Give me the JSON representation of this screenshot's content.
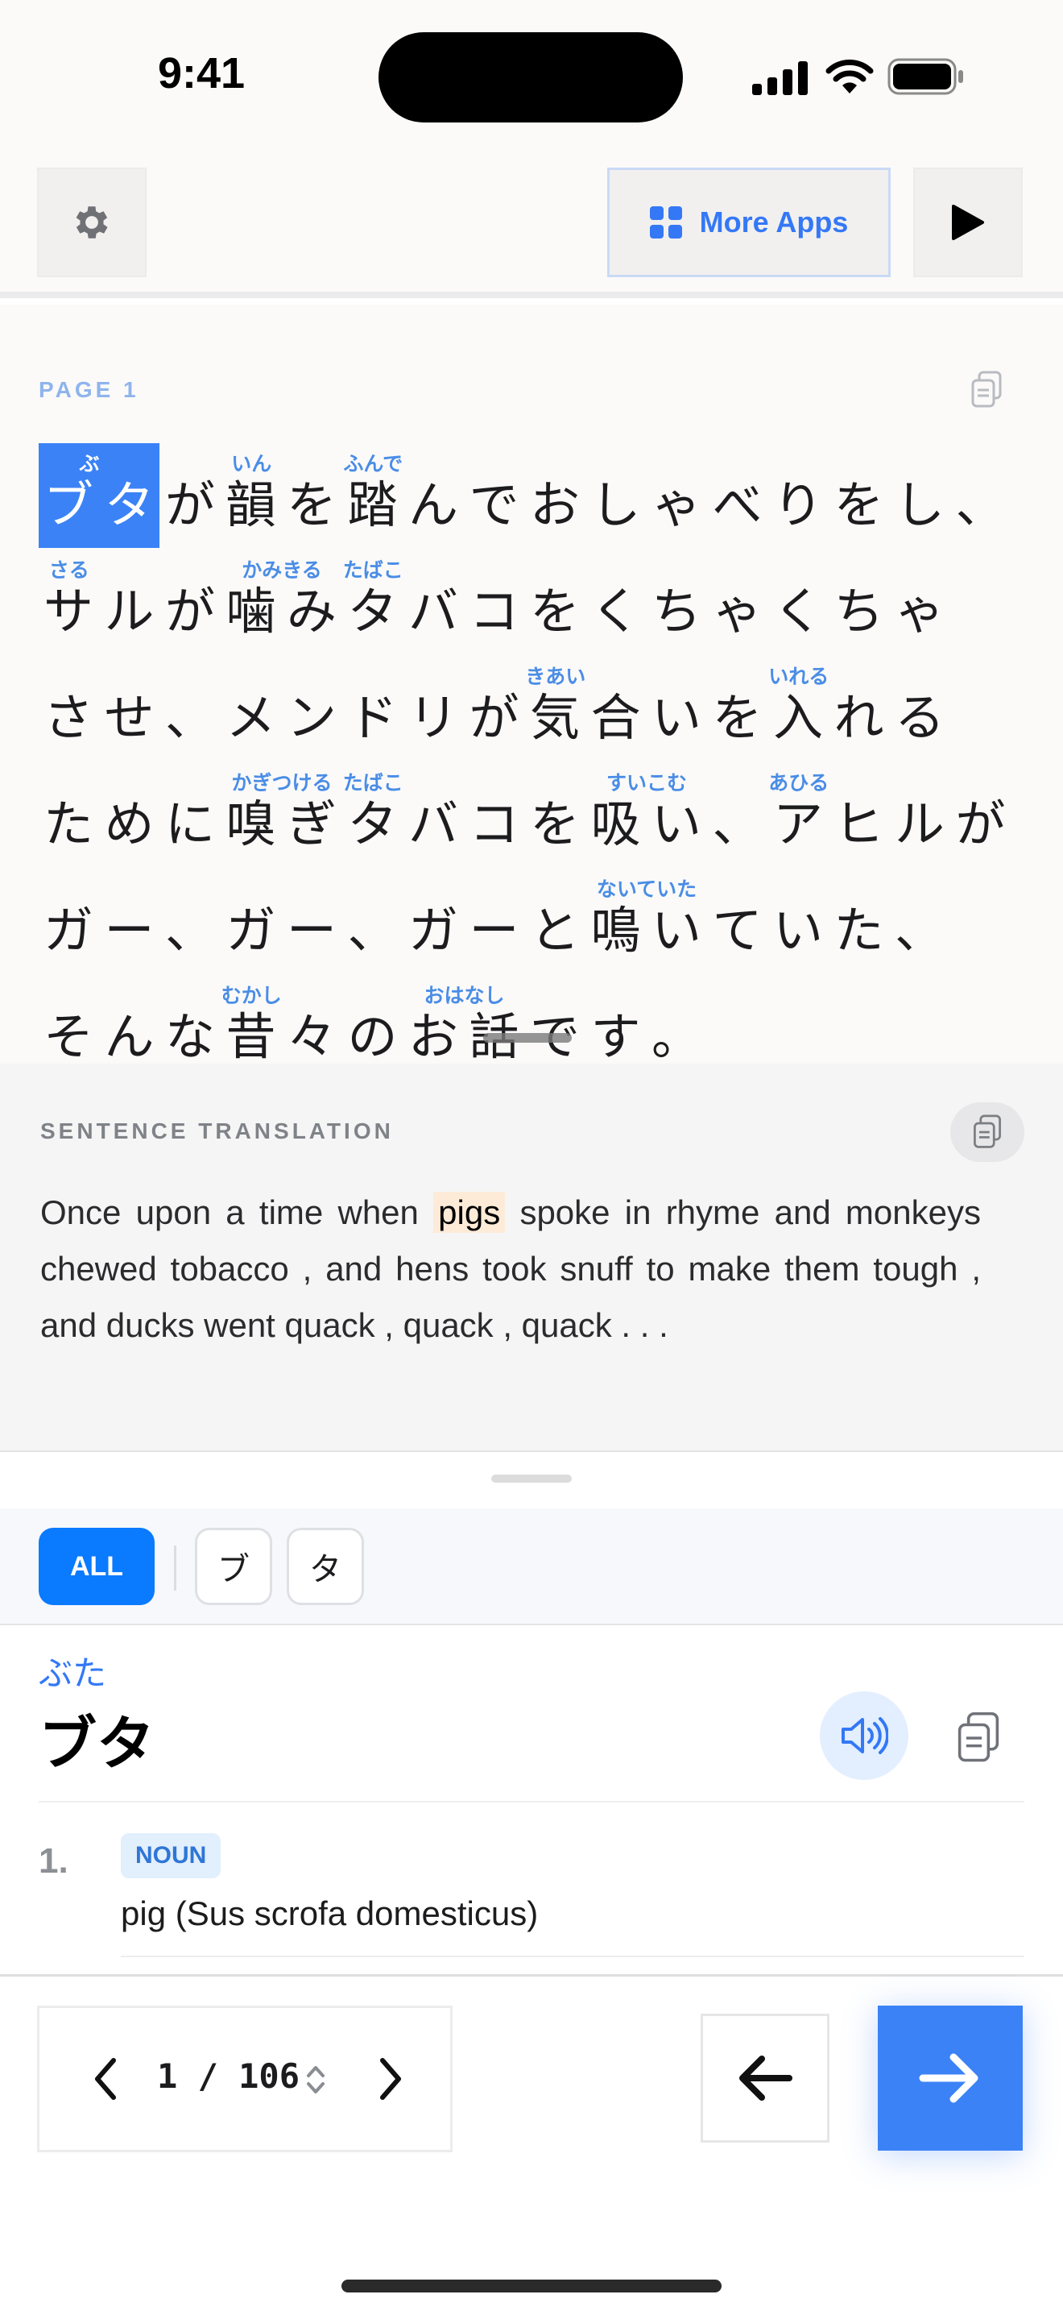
{
  "status": {
    "time": "9:41"
  },
  "toolbar": {
    "more_apps_label": "More Apps"
  },
  "passage": {
    "page_label": "PAGE 1",
    "lines": [
      [
        {
          "c": "ブ",
          "r": "ぶた",
          "hl": true
        },
        {
          "c": "タ",
          "hl": true
        },
        {
          "c": "が"
        },
        {
          "c": "韻",
          "r": "いん"
        },
        {
          "c": "を"
        },
        {
          "c": "踏",
          "r": "ふんで"
        },
        {
          "c": "ん"
        },
        {
          "c": "で"
        },
        {
          "c": "お"
        },
        {
          "c": "し"
        },
        {
          "c": "ゃ"
        },
        {
          "c": "べ"
        },
        {
          "c": "り"
        },
        {
          "c": "を"
        },
        {
          "c": "し"
        },
        {
          "c": "、"
        }
      ],
      [
        {
          "c": "サ",
          "r": "さる"
        },
        {
          "c": "ル"
        },
        {
          "c": "が"
        },
        {
          "c": "噛",
          "r": "かみきる"
        },
        {
          "c": "み"
        },
        {
          "c": "タ",
          "r": "たばこ"
        },
        {
          "c": "バ"
        },
        {
          "c": "コ"
        },
        {
          "c": "を"
        },
        {
          "c": "く"
        },
        {
          "c": "ち"
        },
        {
          "c": "ゃ"
        },
        {
          "c": "く"
        },
        {
          "c": "ち"
        },
        {
          "c": "ゃ"
        }
      ],
      [
        {
          "c": "さ"
        },
        {
          "c": "せ"
        },
        {
          "c": "、"
        },
        {
          "c": "メ"
        },
        {
          "c": "ン"
        },
        {
          "c": "ド"
        },
        {
          "c": "リ"
        },
        {
          "c": "が"
        },
        {
          "c": "気",
          "r": "きあい"
        },
        {
          "c": "合"
        },
        {
          "c": "い"
        },
        {
          "c": "を"
        },
        {
          "c": "入",
          "r": "いれる"
        },
        {
          "c": "れ"
        },
        {
          "c": "る"
        }
      ],
      [
        {
          "c": "た"
        },
        {
          "c": "め"
        },
        {
          "c": "に"
        },
        {
          "c": "嗅",
          "r": "かぎつける"
        },
        {
          "c": "ぎ"
        },
        {
          "c": "タ",
          "r": "たばこ"
        },
        {
          "c": "バ"
        },
        {
          "c": "コ"
        },
        {
          "c": "を"
        },
        {
          "c": "吸",
          "r": "すいこむ"
        },
        {
          "c": "い"
        },
        {
          "c": "、"
        },
        {
          "c": "ア",
          "r": "あひる"
        },
        {
          "c": "ヒ"
        },
        {
          "c": "ル"
        },
        {
          "c": "が"
        }
      ],
      [
        {
          "c": "ガ"
        },
        {
          "c": "ー"
        },
        {
          "c": "、"
        },
        {
          "c": "ガ"
        },
        {
          "c": "ー"
        },
        {
          "c": "、"
        },
        {
          "c": "ガ"
        },
        {
          "c": "ー"
        },
        {
          "c": "と"
        },
        {
          "c": "鳴",
          "r": "ないていた"
        },
        {
          "c": "い"
        },
        {
          "c": "て"
        },
        {
          "c": "い"
        },
        {
          "c": "た"
        },
        {
          "c": "、"
        }
      ],
      [
        {
          "c": "そ"
        },
        {
          "c": "ん"
        },
        {
          "c": "な"
        },
        {
          "c": "昔",
          "r": "むかし"
        },
        {
          "c": "々"
        },
        {
          "c": "の"
        },
        {
          "c": "お",
          "r": "おはなし"
        },
        {
          "c": "話"
        },
        {
          "c": "で"
        },
        {
          "c": "す"
        },
        {
          "c": "。"
        }
      ]
    ]
  },
  "translation": {
    "heading": "SENTENCE TRANSLATION",
    "before": "Once upon a time when ",
    "highlight": "pigs",
    "after": " spoke in rhyme and monkeys chewed tobacco , and hens took snuff to make them tough , and ducks went quack , quack , quack . . ."
  },
  "filters": {
    "all_label": "ALL",
    "chips": [
      "ブ",
      "タ"
    ]
  },
  "entry": {
    "reading": "ぶた",
    "word": "ブタ",
    "sense_number": "1.",
    "pos": "NOUN",
    "gloss": "pig (Sus scrofa domesticus)"
  },
  "pager": {
    "current": "1",
    "total": "106",
    "display": "1 / 106"
  },
  "colors": {
    "accent": "#3b82f6",
    "chip_active": "#0a7aff",
    "ruby": "#4a8de6",
    "highlight": "#fdebd8"
  }
}
